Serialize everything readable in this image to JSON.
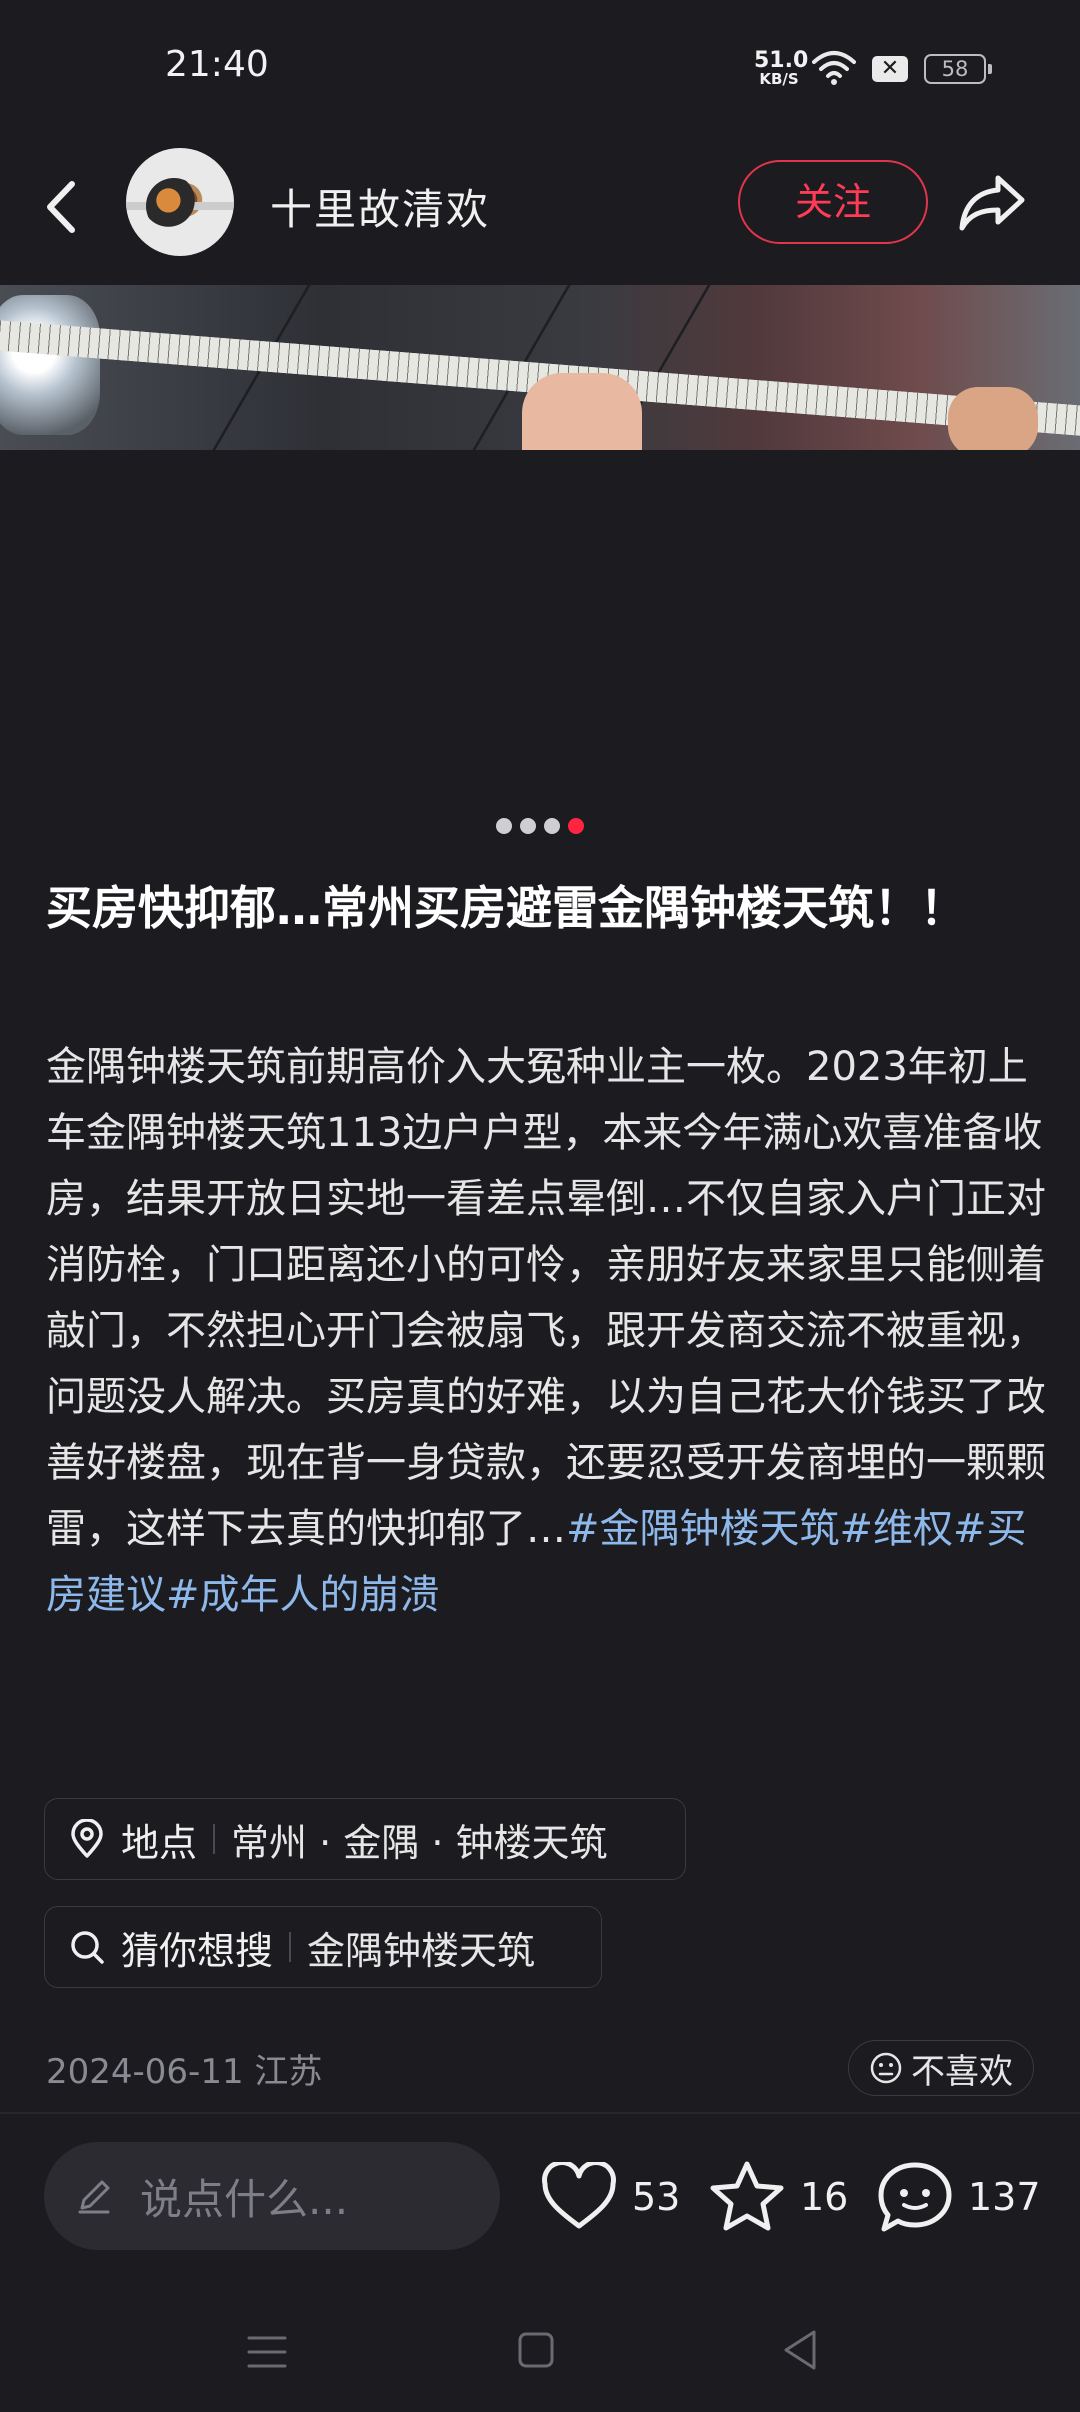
{
  "status_bar": {
    "time": "21:40",
    "net_speed_value": "51.0",
    "net_speed_unit": "KB/S",
    "battery": "58"
  },
  "header": {
    "author_name": "十里故清欢",
    "follow_label": "关注"
  },
  "carousel": {
    "count": 4,
    "active_index": 3
  },
  "post": {
    "title": "买房快抑郁…常州买房避雷金隅钟楼天筑！！",
    "body_text": "金隅钟楼天筑前期高价入大冤种业主一枚。2023年初上车金隅钟楼天筑113边户户型，本来今年满心欢喜准备收房，结果开放日实地一看差点晕倒…不仅自家入户门正对消防栓，门口距离还小的可怜，亲朋好友来家里只能侧着敲门，不然担心开门会被扇飞，跟开发商交流不被重视，问题没人解决。买房真的好难，以为自己花大价钱买了改善好楼盘，现在背一身贷款，还要忍受开发商埋的一颗颗雷，这样下去真的快抑郁了…",
    "tags": "#金隅钟楼天筑#维权#买房建议#成年人的崩溃"
  },
  "location_chip": {
    "label": "地点",
    "value": "常州 · 金隅 · 钟楼天筑"
  },
  "search_chip": {
    "label": "猜你想搜",
    "value": "金隅钟楼天筑"
  },
  "meta": {
    "date_region": "2024-06-11 江苏",
    "dislike_label": "不喜欢"
  },
  "actions": {
    "comment_placeholder": "说点什么...",
    "likes": "53",
    "collects": "16",
    "comments": "137"
  },
  "colors": {
    "accent": "#ff2442",
    "tag": "#8eb8ea",
    "background": "#1b1b20"
  }
}
